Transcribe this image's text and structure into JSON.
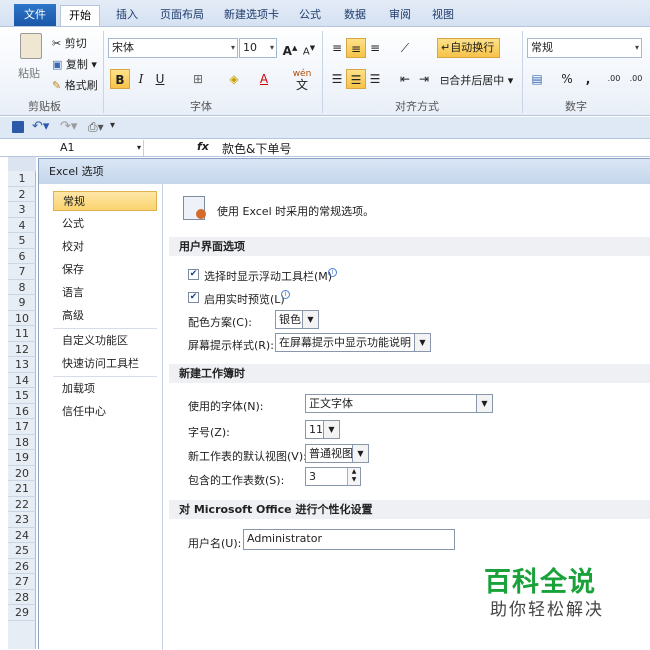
{
  "ribbon_tabs": [
    "文件",
    "开始",
    "插入",
    "页面布局",
    "新建选项卡",
    "公式",
    "数据",
    "审阅",
    "视图"
  ],
  "clipboard": {
    "paste": "粘贴",
    "cut": "剪切",
    "copy": "复制",
    "format_painter": "格式刷",
    "group": "剪贴板"
  },
  "font": {
    "name": "宋体",
    "size": "10",
    "grow": "A",
    "shrink": "A",
    "bold": "B",
    "italic": "I",
    "underline": "U",
    "group": "字体",
    "wen": "wén",
    "wen_char": "文"
  },
  "alignment": {
    "wrap": "自动换行",
    "merge": "合并后居中",
    "group": "对齐方式"
  },
  "number": {
    "format": "常规",
    "percent": "%",
    "comma": ",",
    "group": "数字",
    "inc_decimal": ".00",
    "dec_decimal": ".00"
  },
  "formula_bar": {
    "name_box": "A1",
    "fx": "fx",
    "content": "款色&下单号"
  },
  "rows": [
    "1",
    "2",
    "3",
    "4",
    "5",
    "6",
    "7",
    "8",
    "9",
    "10",
    "11",
    "12",
    "13",
    "14",
    "15",
    "16",
    "17",
    "18",
    "19",
    "20",
    "21",
    "22",
    "23",
    "24",
    "25",
    "26",
    "27",
    "28",
    "29"
  ],
  "dialog": {
    "title": "Excel 选项",
    "nav": [
      "常规",
      "公式",
      "校对",
      "保存",
      "语言",
      "高级",
      "自定义功能区",
      "快速访问工具栏",
      "加载项",
      "信任中心"
    ],
    "intro": "使用 Excel 时采用的常规选项。",
    "ui_section": "用户界面选项",
    "mini_toolbar": "选择时显示浮动工具栏(M)",
    "live_preview": "启用实时预览(L)",
    "color_scheme_label": "配色方案(C):",
    "color_scheme_value": "银色",
    "screentip_label": "屏幕提示样式(R):",
    "screentip_value": "在屏幕提示中显示功能说明",
    "new_wb_section": "新建工作簿时",
    "font_label": "使用的字体(N):",
    "font_value": "正文字体",
    "size_label": "字号(Z):",
    "size_value": "11",
    "view_label": "新工作表的默认视图(V):",
    "view_value": "普通视图",
    "sheets_label": "包含的工作表数(S):",
    "sheets_value": "3",
    "personal_section": "对 Microsoft Office 进行个性化设置",
    "username_label": "用户名(U):",
    "username_value": "Administrator"
  },
  "watermark": {
    "title": "百科全说",
    "subtitle": "助你轻松解决"
  },
  "colors": {
    "accent": "#1a57a8",
    "selected_nav": "#fbd46f",
    "watermark": "#1aa23a"
  }
}
